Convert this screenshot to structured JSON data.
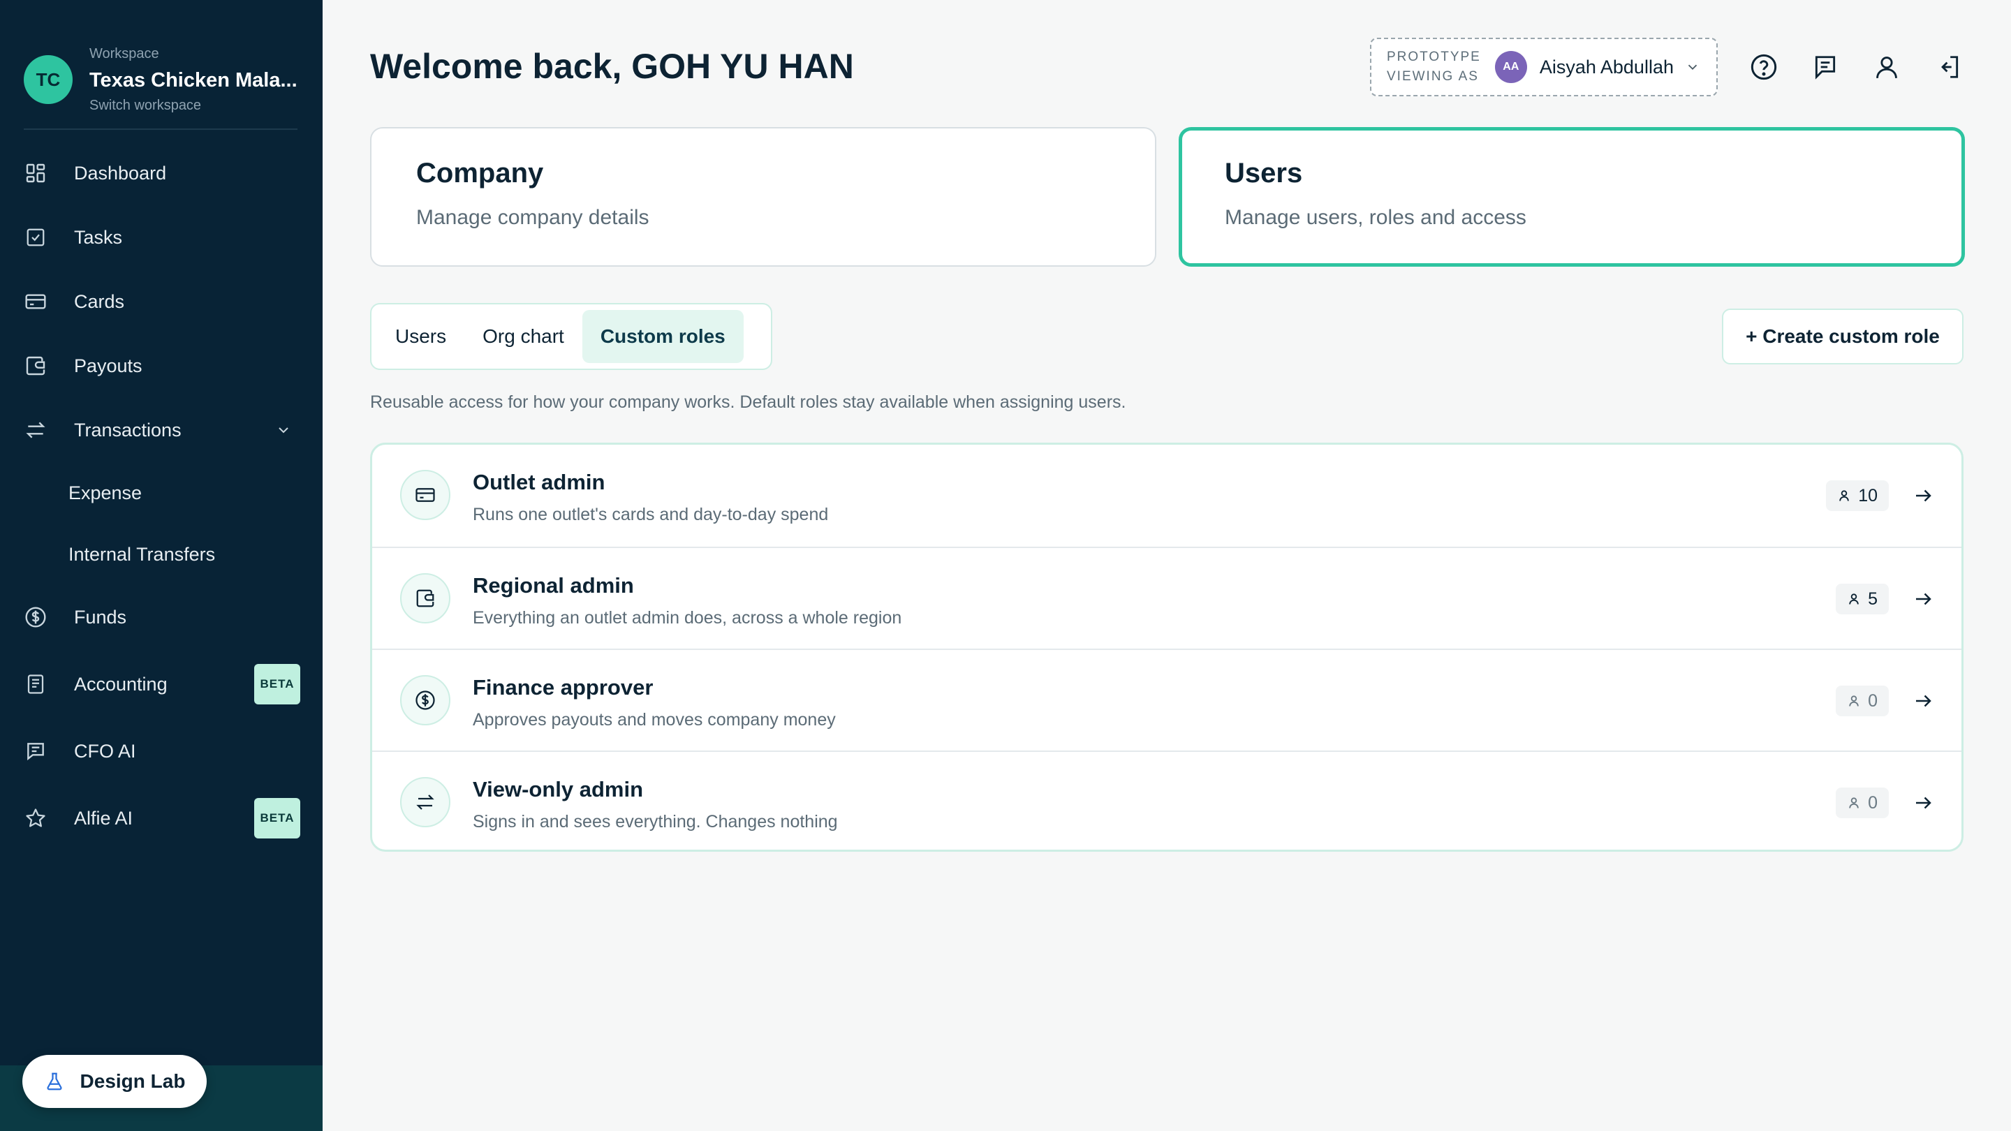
{
  "workspace": {
    "label": "Workspace",
    "initials": "TC",
    "name": "Texas Chicken Mala...",
    "switch_label": "Switch workspace"
  },
  "sidebar": {
    "items": [
      {
        "label": "Dashboard",
        "icon": "grid-icon"
      },
      {
        "label": "Tasks",
        "icon": "checkbox-icon"
      },
      {
        "label": "Cards",
        "icon": "card-icon"
      },
      {
        "label": "Payouts",
        "icon": "wallet-icon"
      },
      {
        "label": "Transactions",
        "icon": "transfer-icon"
      },
      {
        "label": "Expense"
      },
      {
        "label": "Internal Transfers"
      },
      {
        "label": "Funds",
        "icon": "dollar-circle-icon"
      },
      {
        "label": "Accounting",
        "icon": "document-icon",
        "badge": "BETA"
      },
      {
        "label": "CFO AI",
        "icon": "chat-icon"
      },
      {
        "label": "Alfie AI",
        "icon": "star-icon",
        "badge": "BETA"
      }
    ],
    "design_lab_label": "Design Lab"
  },
  "header": {
    "title": "Welcome back, GOH YU HAN",
    "prototype_label_1": "PROTOTYPE",
    "prototype_label_2": "VIEWING AS",
    "viewer_initials": "AA",
    "viewer_name": "Aisyah Abdullah"
  },
  "cards": [
    {
      "title": "Company",
      "subtitle": "Manage company details"
    },
    {
      "title": "Users",
      "subtitle": "Manage users, roles and access"
    }
  ],
  "tabs": [
    "Users",
    "Org chart",
    "Custom roles"
  ],
  "create_button_label": "+ Create custom role",
  "description": "Reusable access for how your company works. Default roles stay available when assigning users.",
  "roles": [
    {
      "name": "Outlet admin",
      "description": "Runs one outlet's cards and day-to-day spend",
      "count": "10",
      "icon": "card-icon"
    },
    {
      "name": "Regional admin",
      "description": "Everything an outlet admin does, across a whole region",
      "count": "5",
      "icon": "wallet-icon"
    },
    {
      "name": "Finance approver",
      "description": "Approves payouts and moves company money",
      "count": "0",
      "icon": "dollar-circle-icon"
    },
    {
      "name": "View-only admin",
      "description": "Signs in and sees everything. Changes nothing",
      "count": "0",
      "icon": "transfer-icon"
    }
  ],
  "colors": {
    "sidebar_bg": "#082336",
    "accent": "#2ec4a0",
    "beta_badge": "#bff0df",
    "viewer_avatar": "#7b64b8"
  }
}
